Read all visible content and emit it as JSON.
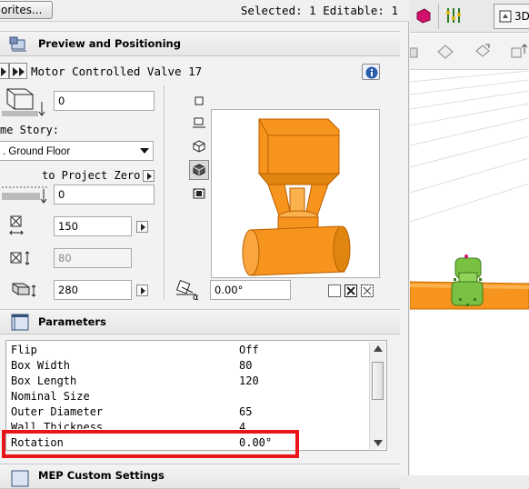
{
  "top_bar": {
    "favorites_label": "orites...",
    "selection_status": "Selected: 1 Editable: 1"
  },
  "preview_section": {
    "title": "Preview and Positioning",
    "object_name": "Motor Controlled Valve 17",
    "elevation_value": "0",
    "home_story_label": "me Story:",
    "home_story_value": ". Ground Floor",
    "to_project_zero_label": "to Project Zero",
    "project_zero_value": "0",
    "width_value": "150",
    "depth_value": "80",
    "height_value": "280",
    "rotation_angle_value": "0.00°"
  },
  "parameters_section": {
    "title": "Parameters",
    "rows": [
      {
        "name": "Flip",
        "value": "Off"
      },
      {
        "name": "Box Width",
        "value": "80"
      },
      {
        "name": "Box Length",
        "value": "120"
      },
      {
        "name": "Nominal Size",
        "value": ""
      },
      {
        "name": "Outer Diameter",
        "value": "65"
      },
      {
        "name": "Wall Thickness",
        "value": "4"
      },
      {
        "name": "Rotation",
        "value": "0.00°"
      }
    ]
  },
  "mep_section": {
    "title": "MEP Custom Settings"
  },
  "viewport": {
    "tab_label": "3D"
  },
  "colors": {
    "object_orange": "#f7941d",
    "highlight_red": "#e8141b",
    "selection_green": "#7ac143"
  }
}
